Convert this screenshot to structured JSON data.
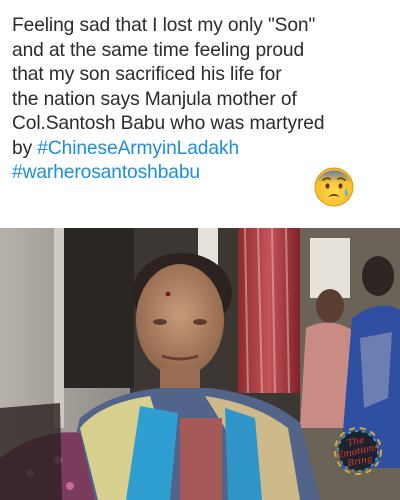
{
  "caption": {
    "lines": [
      "Feeling sad that I lost my only \"Son\"",
      "and at the same time feeling proud",
      "that my son sacrificed his life for",
      "the nation says Manjula mother of",
      "Col.Santosh Babu who was martyred"
    ],
    "line6_prefix": "by ",
    "hashtags": [
      "#ChineseArmyinLadakh",
      "#warherosantoshbabu"
    ]
  },
  "emoji": {
    "icon": "sad-face-emoji-icon"
  },
  "photo": {
    "subject": "woman-in-blue-saree",
    "watermark": {
      "lines": [
        "The",
        "Emotions",
        "Bring"
      ],
      "color": "#e23b2e"
    }
  },
  "colors": {
    "text": "#2b2b2b",
    "hashtag": "#1d8fd9",
    "background": "#ffffff"
  }
}
